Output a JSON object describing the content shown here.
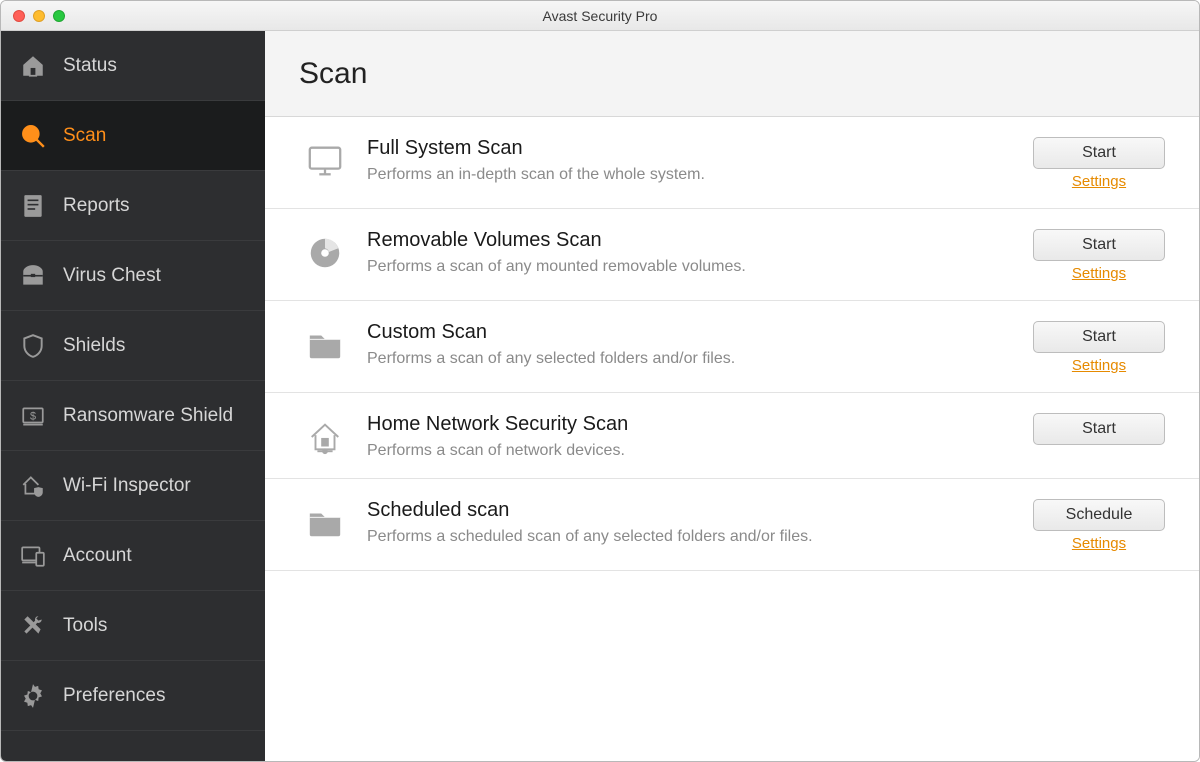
{
  "window": {
    "title": "Avast Security Pro"
  },
  "sidebar": {
    "items": [
      {
        "id": "status",
        "label": "Status"
      },
      {
        "id": "scan",
        "label": "Scan",
        "active": true
      },
      {
        "id": "reports",
        "label": "Reports"
      },
      {
        "id": "virus-chest",
        "label": "Virus Chest"
      },
      {
        "id": "shields",
        "label": "Shields"
      },
      {
        "id": "ransomware-shield",
        "label": "Ransomware Shield"
      },
      {
        "id": "wifi-inspector",
        "label": "Wi-Fi Inspector"
      },
      {
        "id": "account",
        "label": "Account"
      },
      {
        "id": "tools",
        "label": "Tools"
      },
      {
        "id": "preferences",
        "label": "Preferences"
      }
    ]
  },
  "main": {
    "title": "Scan",
    "settings_label": "Settings",
    "scans": [
      {
        "icon": "monitor",
        "title": "Full System Scan",
        "desc": "Performs an in-depth scan of the whole system.",
        "button": "Start",
        "has_settings": true
      },
      {
        "icon": "disc",
        "title": "Removable Volumes Scan",
        "desc": "Performs a scan of any mounted removable volumes.",
        "button": "Start",
        "has_settings": true
      },
      {
        "icon": "folder",
        "title": "Custom Scan",
        "desc": "Performs a scan of any selected folders and/or files.",
        "button": "Start",
        "has_settings": true
      },
      {
        "icon": "home-network",
        "title": "Home Network Security Scan",
        "desc": "Performs a scan of network devices.",
        "button": "Start",
        "has_settings": false
      },
      {
        "icon": "folder",
        "title": "Scheduled scan",
        "desc": "Performs a scheduled scan of any selected folders and/or files.",
        "button": "Schedule",
        "has_settings": true
      }
    ]
  }
}
